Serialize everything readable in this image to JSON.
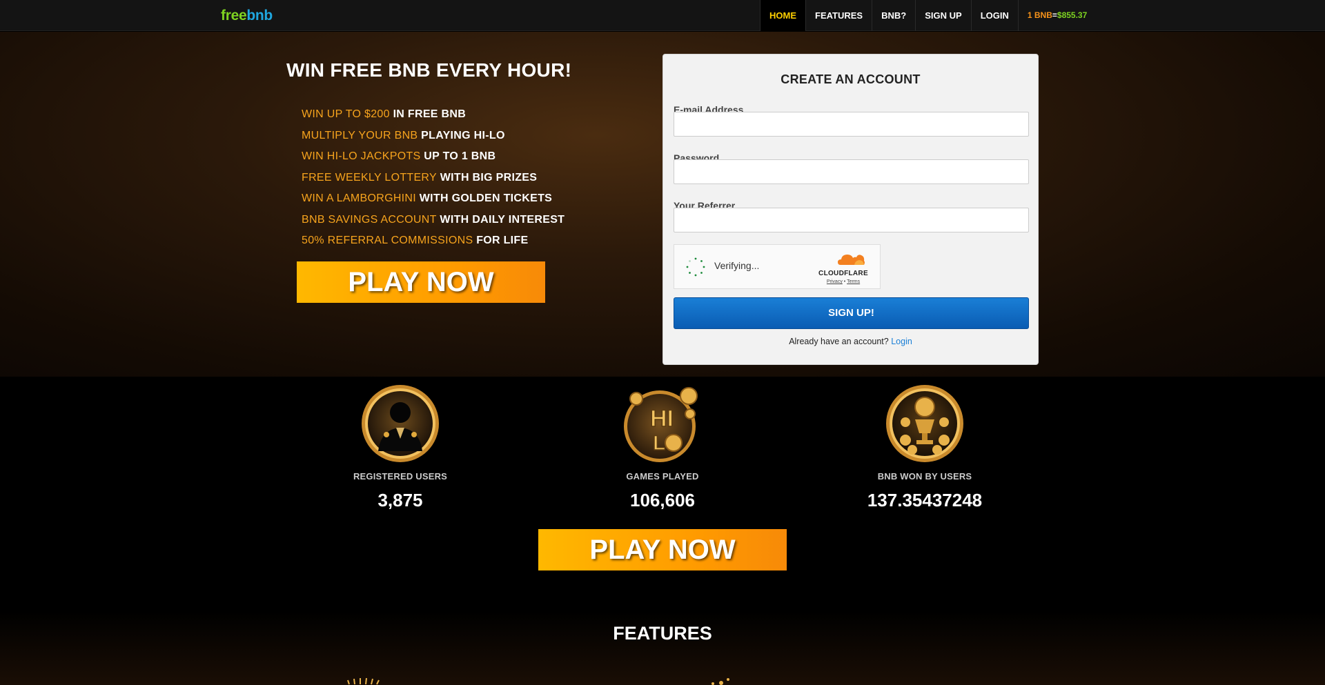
{
  "nav": {
    "logo_free": "free",
    "logo_bnb": "bnb",
    "items": [
      {
        "label": "HOME",
        "active": true
      },
      {
        "label": "FEATURES",
        "active": false
      },
      {
        "label": "BNB?",
        "active": false
      },
      {
        "label": "SIGN UP",
        "active": false
      },
      {
        "label": "LOGIN",
        "active": false
      }
    ],
    "price_coin": "1 BNB",
    "price_eq": "=",
    "price_usd": "$855.37"
  },
  "hero": {
    "title": "WIN FREE BNB EVERY HOUR!",
    "features": [
      {
        "highlight": "WIN UP TO $200",
        "rest": "IN FREE BNB"
      },
      {
        "highlight": "MULTIPLY YOUR BNB",
        "rest": "PLAYING HI-LO"
      },
      {
        "highlight": "WIN HI-LO JACKPOTS",
        "rest": "UP TO 1 BNB"
      },
      {
        "highlight": "FREE WEEKLY LOTTERY",
        "rest": "WITH BIG PRIZES"
      },
      {
        "highlight": "WIN A LAMBORGHINI",
        "rest": "WITH GOLDEN TICKETS"
      },
      {
        "highlight": "BNB SAVINGS ACCOUNT",
        "rest": "WITH DAILY INTEREST"
      },
      {
        "highlight": "50% REFERRAL COMMISSIONS",
        "rest": "FOR LIFE"
      }
    ],
    "play_label": "PLAY NOW"
  },
  "form": {
    "title": "CREATE AN ACCOUNT",
    "email_label": "E-mail Address",
    "email_value": "",
    "password_label": "Password",
    "password_value": "",
    "referrer_label": "Your Referrer",
    "referrer_value": "",
    "captcha_status": "Verifying...",
    "captcha_brand": "CLOUDFLARE",
    "captcha_privacy": "Privacy",
    "captcha_sep": "•",
    "captcha_terms": "Terms",
    "signup_label": "SIGN UP!",
    "already_text": "Already have an account?",
    "login_link": "Login"
  },
  "stats": [
    {
      "label": "REGISTERED USERS",
      "value": "3,875",
      "icon": "user-icon"
    },
    {
      "label": "GAMES PLAYED",
      "value": "106,606",
      "icon": "hilo-icon"
    },
    {
      "label": "BNB WON BY USERS",
      "value": "137.35437248",
      "icon": "trophy-icon"
    }
  ],
  "play_label_2": "PLAY NOW",
  "features_title": "FEATURES",
  "colors": {
    "accent_orange": "#f7a41d",
    "logo_green": "#7ed321",
    "logo_blue": "#1fa7e0",
    "nav_active": "#ffd000",
    "signup_blue": "#0a5cb3"
  }
}
